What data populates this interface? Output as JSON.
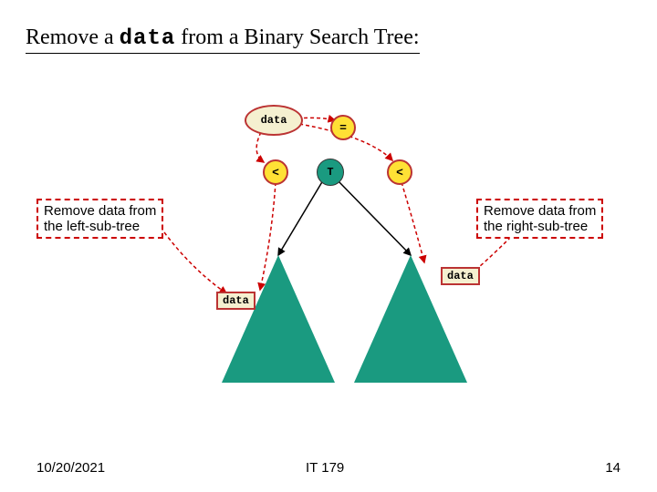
{
  "title": {
    "prefix": "Remove a ",
    "mono": "data",
    "suffix": " from a Binary Search Tree:"
  },
  "nodes": {
    "data_oval": "data",
    "eq": "=",
    "lt_left": "<",
    "lt_right": "<",
    "t": "T"
  },
  "notes": {
    "left": "Remove data from\nthe left-sub-tree",
    "right": "Remove data from\nthe right-sub-tree"
  },
  "data_labels": {
    "left": "data",
    "right": "data"
  },
  "footer": {
    "date": "10/20/2021",
    "course": "IT 179",
    "page": "14"
  }
}
